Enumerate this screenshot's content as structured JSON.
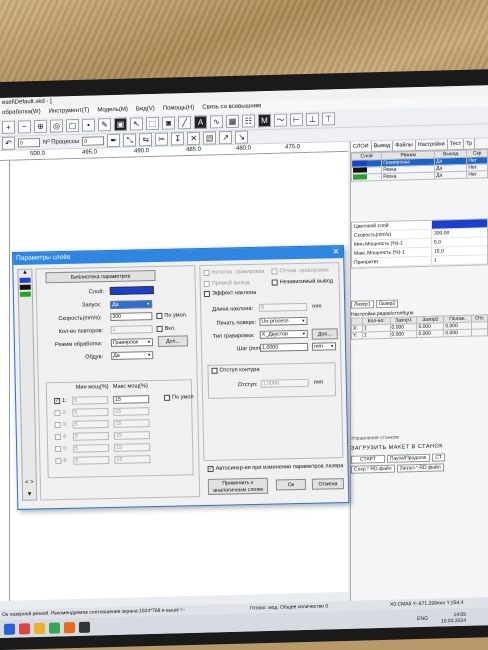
{
  "app": {
    "title": "esel\\Default.xkd - ]",
    "menu": [
      "обработка(W)",
      "Инструмент(T)",
      "Модель(M)",
      "Вид(V)",
      "Помощь(H)",
      "Связь со всевышним"
    ],
    "toolbar2": {
      "left_value": "0",
      "count_label": "Nº Процессы",
      "count_value": "0"
    },
    "ruler_marks": [
      "500.0",
      "495.0",
      "490.0",
      "485.0",
      "480.0",
      "475.0"
    ]
  },
  "right_panel": {
    "tabs": [
      "СЛОИ",
      "Вывод",
      "Файлы",
      "Настройки",
      "Тест",
      "Тр"
    ],
    "table_headers": [
      "Слой",
      "Режим",
      "Вывод",
      "Скр"
    ],
    "rows": [
      {
        "color": "#1a3fd1",
        "mode": "Гравировка",
        "output": "Да",
        "hide": "Нет"
      },
      {
        "color": "#111111",
        "mode": "Резка",
        "output": "Да",
        "hide": "Нет"
      },
      {
        "color": "#2ca02c",
        "mode": "Резка",
        "output": "Да",
        "hide": "Нет"
      }
    ],
    "props": [
      {
        "k": "Цветовой слой",
        "v": ""
      },
      {
        "k": "Скорость(mm/s)",
        "v": "300.00"
      },
      {
        "k": "Мин.Мощность (%)-1",
        "v": "5.0"
      },
      {
        "k": "Макс.Мощность (%)-1",
        "v": "15.0"
      },
      {
        "k": "Приоритет",
        "v": "1"
      }
    ],
    "laser_tabs": [
      "Лазер1",
      "Лазер2"
    ],
    "offset_title": "Настройки рядов/столбцов",
    "offset_headers": [
      "Кол-во:",
      "Зазор1",
      "Зазор2",
      "Полож.",
      "Отс"
    ],
    "offset_rows": [
      {
        "label": "X:",
        "count": "1",
        "g1": "0.000",
        "g2": "0.000",
        "p": "0.000"
      },
      {
        "label": "Y:",
        "count": "1",
        "g1": "0.000",
        "g2": "0.000",
        "p": "0.000"
      }
    ],
    "bottom_panel": {
      "title": "Управление станком",
      "upload": "ЗАГРУЗИТЬ МАКЕТ В СТАНОК",
      "start": "СТАРТ",
      "pause": "Пауза/Продолж.",
      "stop": "СТ",
      "save_file": "Сохр.* RD файл",
      "load_file": "Загруз.* RD файл"
    }
  },
  "dialog": {
    "title": "Параметры слоёв",
    "library_button": "Библиотека параметров",
    "layer_label": "Слой:",
    "layer_color": "#1a3fd1",
    "enable_label": "Запуск:",
    "enable_value": "Да",
    "speed_label": "Скорость(mm/s):",
    "speed_value": "300",
    "by_default": "По умол.",
    "repeat_label": "Кол-во повторов:",
    "repeat_value": "1",
    "on_label": "Вкл.",
    "mode_label": "Режим обработки:",
    "mode_value": "Гравировк",
    "more_button": "Доп...",
    "blow_label": "Обдув:",
    "blow_value": "Да",
    "power_group": {
      "min_header": "Мин мощ(%)",
      "max_header": "Макс мощ(%)",
      "default_label": "По умол",
      "rows": [
        {
          "label": "1:",
          "min": "5",
          "max": "15"
        },
        {
          "label": "2:",
          "min": "5",
          "max": "15"
        },
        {
          "label": "3:",
          "min": "5",
          "max": "15"
        },
        {
          "label": "4:",
          "min": "5",
          "max": "15"
        },
        {
          "label": "5:",
          "min": "5",
          "max": "15"
        },
        {
          "label": "6:",
          "min": "5",
          "max": "15"
        }
      ]
    },
    "engrave": {
      "reverse_label": "Негатив. гравировка",
      "optimize_label": "Оптим. гравировки",
      "direct_label": "Прямой вывод",
      "independent_label": "Независимый вывод",
      "slope_label": "Эффект наклона",
      "slope_len_label": "Длина наклона:",
      "slope_len_value": "5",
      "slope_unit": "mm",
      "print_label": "Печать поверх:",
      "print_value": "Un-process",
      "type_label": "Тип гравировки:",
      "type_value": "X_Двустор",
      "type_more": "Доп...",
      "step_label": "Шаг (mm):",
      "step_value": "1.0000",
      "step_unit": "mm"
    },
    "offset_label": "Отступ контура",
    "offset_value_label": "Отступ:",
    "offset_value": "1.0000",
    "offset_unit": "mm",
    "autoapply_label": "Автосинхр-ия при изменении параметров лазера",
    "apply_button": "Применить к аналогичным слоям",
    "ok_button": "Ок",
    "cancel_button": "Отмена",
    "nav_prev": "<",
    "nav_next": ">"
  },
  "status_bar": "Ок лазерной резкой. Рекомендуемое соотношение экрана 1024*768 и выше !-- ",
  "status_mid": "Готово: мод. Общее количество 0",
  "status_right": "X0.CMA5 Y:-671.299mm Y:254.4",
  "taskbar": {
    "lang": "ENG",
    "time": "14:05",
    "date": "10.03.2024"
  }
}
